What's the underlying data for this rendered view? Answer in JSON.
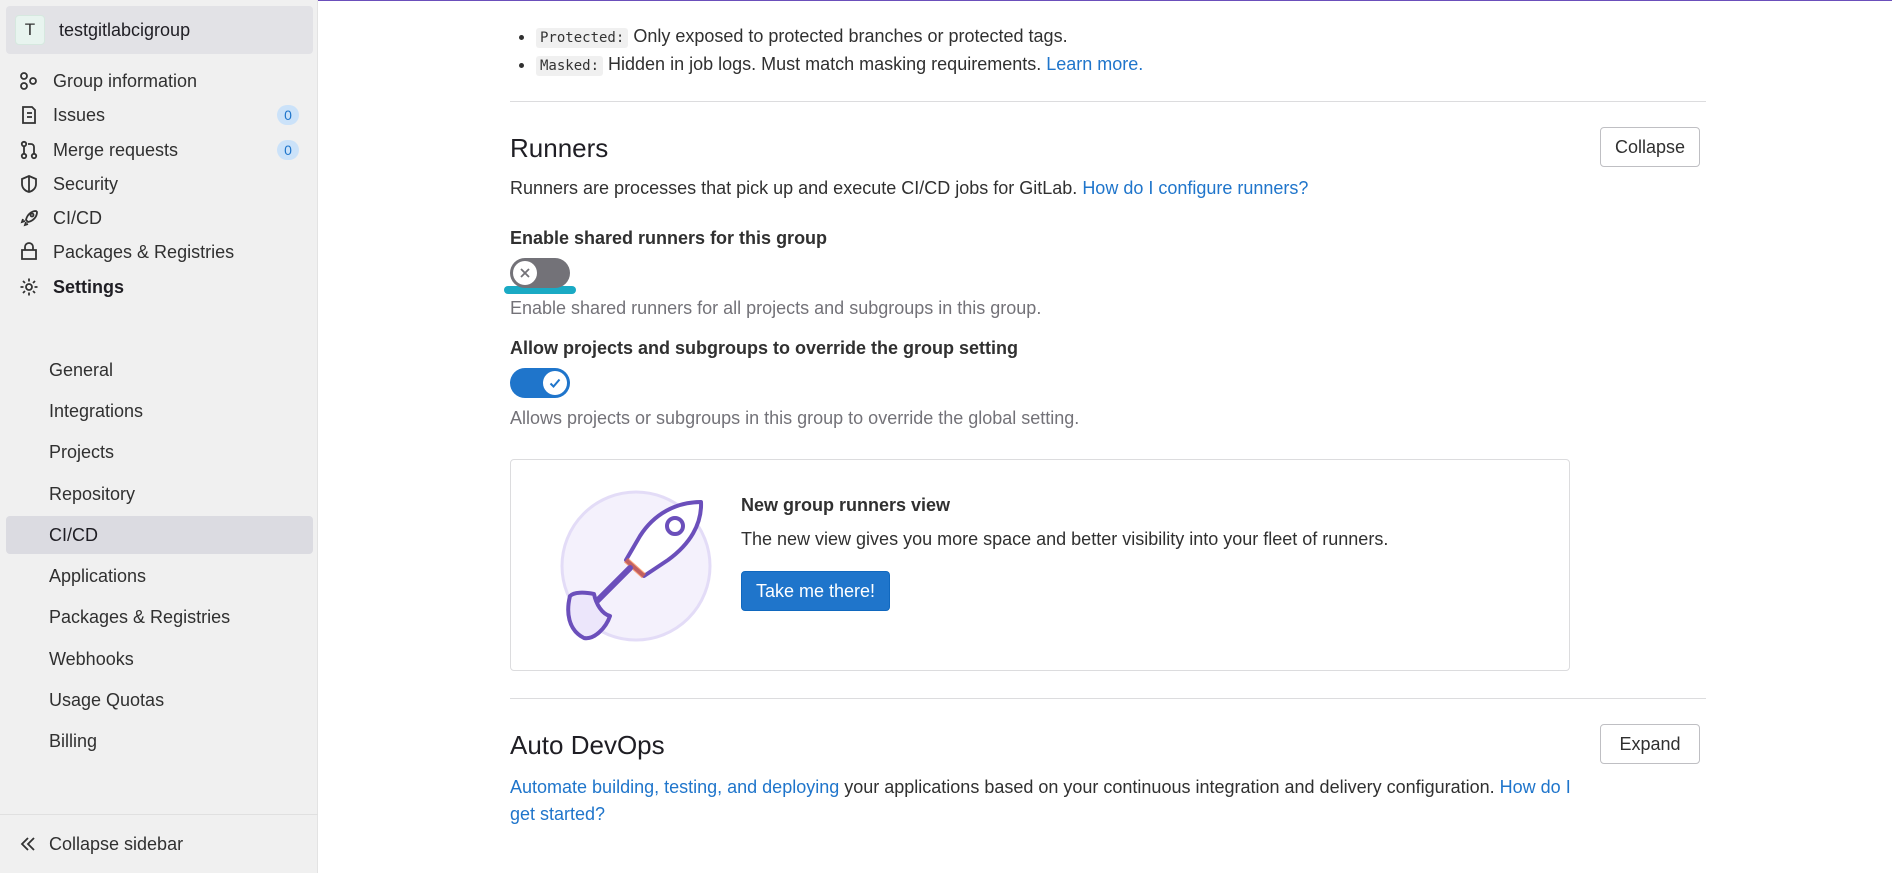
{
  "sidebar": {
    "group": {
      "avatar_letter": "T",
      "name": "testgitlabcigroup"
    },
    "items": [
      {
        "label": "Group information",
        "icon": "group-information-icon"
      },
      {
        "label": "Issues",
        "icon": "issues-icon",
        "count": "0"
      },
      {
        "label": "Merge requests",
        "icon": "merge-request-icon",
        "count": "0"
      },
      {
        "label": "Security",
        "icon": "shield-icon"
      },
      {
        "label": "CI/CD",
        "icon": "rocket-icon"
      },
      {
        "label": "Packages & Registries",
        "icon": "package-icon"
      },
      {
        "label": "Settings",
        "icon": "gear-icon"
      }
    ],
    "settings_sub": [
      "General",
      "Integrations",
      "Projects",
      "Repository",
      "CI/CD",
      "Applications",
      "Packages & Registries",
      "Webhooks",
      "Usage Quotas",
      "Billing"
    ],
    "active_sub": "CI/CD",
    "collapse_label": "Collapse sidebar"
  },
  "variables_notes": {
    "protected_code": "Protected:",
    "protected_text": "Only exposed to protected branches or protected tags.",
    "masked_code": "Masked:",
    "masked_text": "Hidden in job logs. Must match masking requirements.",
    "learn_more": "Learn more."
  },
  "runners": {
    "title": "Runners",
    "collapse_button": "Collapse",
    "description": "Runners are processes that pick up and execute CI/CD jobs for GitLab.",
    "config_link": "How do I configure runners?",
    "shared_label": "Enable shared runners for this group",
    "shared_enabled": false,
    "shared_help": "Enable shared runners for all projects and subgroups in this group.",
    "override_label": "Allow projects and subgroups to override the group setting",
    "override_enabled": true,
    "override_help": "Allows projects or subgroups in this group to override the global setting.",
    "promo": {
      "title": "New group runners view",
      "body": "The new view gives you more space and better visibility into your fleet of runners.",
      "button": "Take me there!"
    }
  },
  "auto_devops": {
    "title": "Auto DevOps",
    "expand_button": "Expand",
    "link1": "Automate building, testing, and deploying",
    "text": " your applications based on your continuous integration and delivery configuration. ",
    "link2": "How do I get started?"
  },
  "colors": {
    "accent": "#1f75cb",
    "toggle_off": "#737278",
    "focus_ring": "#1aaac4",
    "illustration_purple": "#6b4fbb"
  }
}
